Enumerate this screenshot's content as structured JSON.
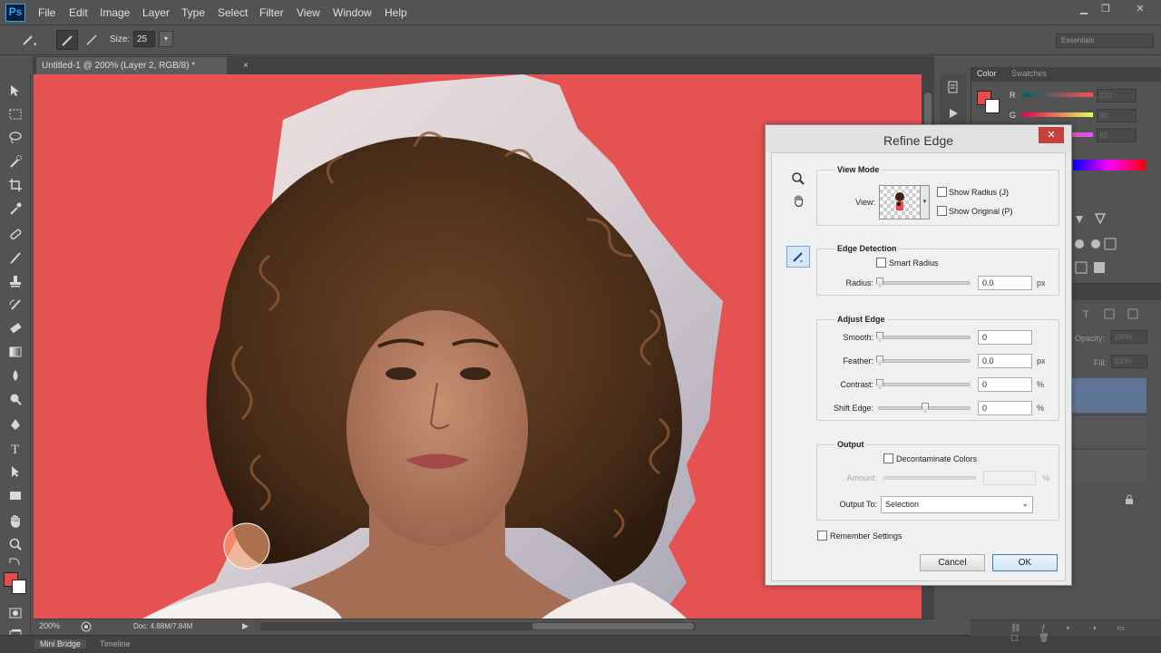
{
  "app": {
    "logo": "Ps"
  },
  "menu": [
    "File",
    "Edit",
    "Image",
    "Layer",
    "Type",
    "Select",
    "Filter",
    "View",
    "Window",
    "Help"
  ],
  "window_controls": {
    "minimize": "▁",
    "restore": "❐",
    "close": "✕"
  },
  "options_bar": {
    "size_label": "Size:",
    "size_value": "25",
    "workspace": "Essentials"
  },
  "document": {
    "tab_title": "Untitled-1 @ 200% (Layer 2, RGB/8) *",
    "tab_close": "×"
  },
  "status_bar": {
    "zoom": "200%",
    "doc_info": "Doc: 4.88M/7.84M"
  },
  "bottom_tabs": [
    "Mini Bridge",
    "Timeline"
  ],
  "color_panel": {
    "tabs": [
      "Color",
      "Swatches"
    ],
    "channels": [
      {
        "label": "R",
        "value": "230"
      },
      {
        "label": "G",
        "value": "80"
      },
      {
        "label": "B",
        "value": "82"
      }
    ]
  },
  "layers_panel": {
    "opacity_label": "Opacity:",
    "opacity_value": "100%",
    "fill_label": "Fill:",
    "fill_value": "100%"
  },
  "colors": {
    "foreground": "#e84c4c",
    "background": "#ffffff",
    "canvas_red": "#e55252"
  },
  "dialog": {
    "title": "Refine Edge",
    "close_label": "✕",
    "view_mode": {
      "title": "View Mode",
      "view_label": "View:",
      "show_radius": "Show Radius (J)",
      "show_original": "Show Original (P)"
    },
    "edge_detection": {
      "title": "Edge Detection",
      "smart_radius": "Smart Radius",
      "radius_label": "Radius:",
      "radius_value": "0.0",
      "radius_unit": "px"
    },
    "adjust_edge": {
      "title": "Adjust Edge",
      "smooth_label": "Smooth:",
      "smooth_value": "0",
      "feather_label": "Feather:",
      "feather_value": "0.0",
      "feather_unit": "px",
      "contrast_label": "Contrast:",
      "contrast_value": "0",
      "contrast_unit": "%",
      "shift_label": "Shift Edge:",
      "shift_value": "0",
      "shift_unit": "%"
    },
    "output": {
      "title": "Output",
      "decontaminate": "Decontaminate Colors",
      "amount_label": "Amount:",
      "amount_unit": "%",
      "output_to_label": "Output To:",
      "output_to_value": "Selection"
    },
    "remember_settings": "Remember Settings",
    "cancel": "Cancel",
    "ok": "OK"
  }
}
